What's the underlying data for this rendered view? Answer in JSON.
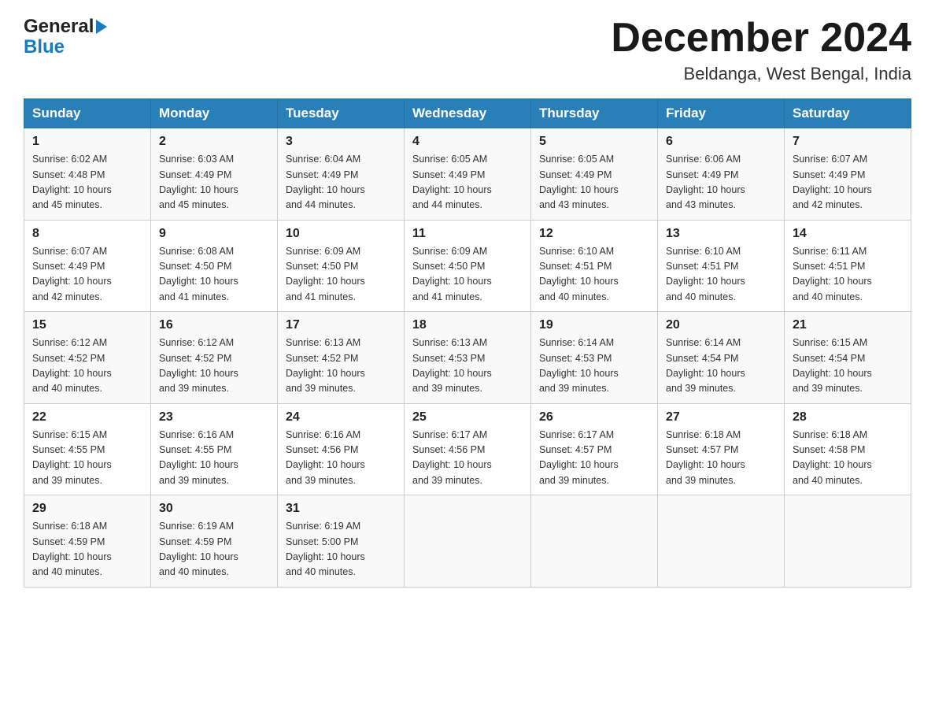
{
  "header": {
    "logo_general": "General",
    "logo_blue": "Blue",
    "month_title": "December 2024",
    "location": "Beldanga, West Bengal, India"
  },
  "weekdays": [
    "Sunday",
    "Monday",
    "Tuesday",
    "Wednesday",
    "Thursday",
    "Friday",
    "Saturday"
  ],
  "weeks": [
    [
      {
        "day": "1",
        "sunrise": "6:02 AM",
        "sunset": "4:48 PM",
        "daylight": "10 hours and 45 minutes."
      },
      {
        "day": "2",
        "sunrise": "6:03 AM",
        "sunset": "4:49 PM",
        "daylight": "10 hours and 45 minutes."
      },
      {
        "day": "3",
        "sunrise": "6:04 AM",
        "sunset": "4:49 PM",
        "daylight": "10 hours and 44 minutes."
      },
      {
        "day": "4",
        "sunrise": "6:05 AM",
        "sunset": "4:49 PM",
        "daylight": "10 hours and 44 minutes."
      },
      {
        "day": "5",
        "sunrise": "6:05 AM",
        "sunset": "4:49 PM",
        "daylight": "10 hours and 43 minutes."
      },
      {
        "day": "6",
        "sunrise": "6:06 AM",
        "sunset": "4:49 PM",
        "daylight": "10 hours and 43 minutes."
      },
      {
        "day": "7",
        "sunrise": "6:07 AM",
        "sunset": "4:49 PM",
        "daylight": "10 hours and 42 minutes."
      }
    ],
    [
      {
        "day": "8",
        "sunrise": "6:07 AM",
        "sunset": "4:49 PM",
        "daylight": "10 hours and 42 minutes."
      },
      {
        "day": "9",
        "sunrise": "6:08 AM",
        "sunset": "4:50 PM",
        "daylight": "10 hours and 41 minutes."
      },
      {
        "day": "10",
        "sunrise": "6:09 AM",
        "sunset": "4:50 PM",
        "daylight": "10 hours and 41 minutes."
      },
      {
        "day": "11",
        "sunrise": "6:09 AM",
        "sunset": "4:50 PM",
        "daylight": "10 hours and 41 minutes."
      },
      {
        "day": "12",
        "sunrise": "6:10 AM",
        "sunset": "4:51 PM",
        "daylight": "10 hours and 40 minutes."
      },
      {
        "day": "13",
        "sunrise": "6:10 AM",
        "sunset": "4:51 PM",
        "daylight": "10 hours and 40 minutes."
      },
      {
        "day": "14",
        "sunrise": "6:11 AM",
        "sunset": "4:51 PM",
        "daylight": "10 hours and 40 minutes."
      }
    ],
    [
      {
        "day": "15",
        "sunrise": "6:12 AM",
        "sunset": "4:52 PM",
        "daylight": "10 hours and 40 minutes."
      },
      {
        "day": "16",
        "sunrise": "6:12 AM",
        "sunset": "4:52 PM",
        "daylight": "10 hours and 39 minutes."
      },
      {
        "day": "17",
        "sunrise": "6:13 AM",
        "sunset": "4:52 PM",
        "daylight": "10 hours and 39 minutes."
      },
      {
        "day": "18",
        "sunrise": "6:13 AM",
        "sunset": "4:53 PM",
        "daylight": "10 hours and 39 minutes."
      },
      {
        "day": "19",
        "sunrise": "6:14 AM",
        "sunset": "4:53 PM",
        "daylight": "10 hours and 39 minutes."
      },
      {
        "day": "20",
        "sunrise": "6:14 AM",
        "sunset": "4:54 PM",
        "daylight": "10 hours and 39 minutes."
      },
      {
        "day": "21",
        "sunrise": "6:15 AM",
        "sunset": "4:54 PM",
        "daylight": "10 hours and 39 minutes."
      }
    ],
    [
      {
        "day": "22",
        "sunrise": "6:15 AM",
        "sunset": "4:55 PM",
        "daylight": "10 hours and 39 minutes."
      },
      {
        "day": "23",
        "sunrise": "6:16 AM",
        "sunset": "4:55 PM",
        "daylight": "10 hours and 39 minutes."
      },
      {
        "day": "24",
        "sunrise": "6:16 AM",
        "sunset": "4:56 PM",
        "daylight": "10 hours and 39 minutes."
      },
      {
        "day": "25",
        "sunrise": "6:17 AM",
        "sunset": "4:56 PM",
        "daylight": "10 hours and 39 minutes."
      },
      {
        "day": "26",
        "sunrise": "6:17 AM",
        "sunset": "4:57 PM",
        "daylight": "10 hours and 39 minutes."
      },
      {
        "day": "27",
        "sunrise": "6:18 AM",
        "sunset": "4:57 PM",
        "daylight": "10 hours and 39 minutes."
      },
      {
        "day": "28",
        "sunrise": "6:18 AM",
        "sunset": "4:58 PM",
        "daylight": "10 hours and 40 minutes."
      }
    ],
    [
      {
        "day": "29",
        "sunrise": "6:18 AM",
        "sunset": "4:59 PM",
        "daylight": "10 hours and 40 minutes."
      },
      {
        "day": "30",
        "sunrise": "6:19 AM",
        "sunset": "4:59 PM",
        "daylight": "10 hours and 40 minutes."
      },
      {
        "day": "31",
        "sunrise": "6:19 AM",
        "sunset": "5:00 PM",
        "daylight": "10 hours and 40 minutes."
      },
      null,
      null,
      null,
      null
    ]
  ],
  "labels": {
    "sunrise": "Sunrise:",
    "sunset": "Sunset:",
    "daylight": "Daylight:"
  }
}
